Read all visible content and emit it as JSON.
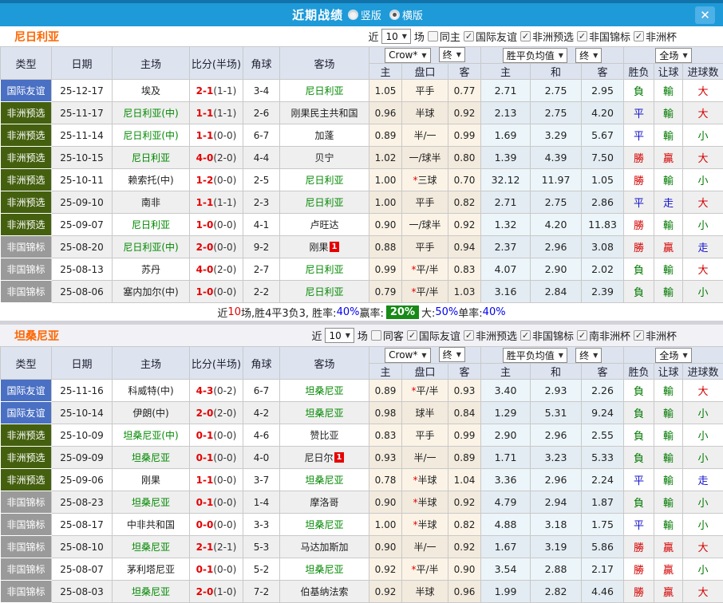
{
  "titlebar": {
    "title": "近期战绩",
    "radio_options": [
      {
        "label": "竖版",
        "selected": false
      },
      {
        "label": "横版",
        "selected": true
      }
    ],
    "close_icon": "✕"
  },
  "table_header": {
    "cols": [
      "类型",
      "日期",
      "主场",
      "比分(半场)",
      "角球",
      "客场"
    ],
    "odds_sub": [
      "主",
      "盘口",
      "客"
    ],
    "avg_sub": [
      "主",
      "和",
      "客"
    ],
    "result_sub": [
      "胜负",
      "让球",
      "进球数"
    ],
    "bookmaker_select": "Crow*",
    "final_select": "终",
    "avg_select": "胜平负均值",
    "avg_final_select": "终",
    "scope_select": "全场"
  },
  "sections": [
    {
      "team": "尼日利亚",
      "filter": {
        "prefix": "近",
        "count": "10",
        "suffix": "场",
        "same": {
          "label": "同主",
          "checked": false
        },
        "comps": [
          {
            "label": "国际友谊",
            "checked": true
          },
          {
            "label": "非洲预选",
            "checked": true
          },
          {
            "label": "非国锦标",
            "checked": true
          },
          {
            "label": "非洲杯",
            "checked": true
          }
        ]
      },
      "rows": [
        {
          "type": "国际友谊",
          "type_class": "friendly",
          "date": "25-12-17",
          "home": "埃及",
          "home_self": false,
          "home_badge": "",
          "ft": "2-1",
          "ht": "(1-1)",
          "corners": "3-4",
          "away": "尼日利亚",
          "away_self": true,
          "away_badge": "",
          "o1": "1.05",
          "star": false,
          "hcap": "平手",
          "o2": "0.77",
          "m1": "2.71",
          "m2": "2.75",
          "m3": "2.95",
          "r1": "負",
          "c1": "green",
          "r2": "輸",
          "c2": "green",
          "r3": "大",
          "c3": "red"
        },
        {
          "type": "非洲预选",
          "type_class": "qualifier",
          "date": "25-11-17",
          "home": "尼日利亚(中)",
          "home_self": true,
          "home_badge": "",
          "ft": "1-1",
          "ht": "(1-1)",
          "corners": "2-6",
          "away": "刚果民主共和国",
          "away_self": false,
          "away_badge": "",
          "o1": "0.96",
          "star": false,
          "hcap": "半球",
          "o2": "0.92",
          "m1": "2.13",
          "m2": "2.75",
          "m3": "4.20",
          "r1": "平",
          "c1": "blue",
          "r2": "輸",
          "c2": "green",
          "r3": "大",
          "c3": "red"
        },
        {
          "type": "非洲预选",
          "type_class": "qualifier",
          "date": "25-11-14",
          "home": "尼日利亚(中)",
          "home_self": true,
          "home_badge": "",
          "ft": "1-1",
          "ht": "(0-0)",
          "corners": "6-7",
          "away": "加蓬",
          "away_self": false,
          "away_badge": "",
          "o1": "0.89",
          "star": false,
          "hcap": "半/一",
          "o2": "0.99",
          "m1": "1.69",
          "m2": "3.29",
          "m3": "5.67",
          "r1": "平",
          "c1": "blue",
          "r2": "輸",
          "c2": "green",
          "r3": "小",
          "c3": "green"
        },
        {
          "type": "非洲预选",
          "type_class": "qualifier",
          "date": "25-10-15",
          "home": "尼日利亚",
          "home_self": true,
          "home_badge": "",
          "ft": "4-0",
          "ht": "(2-0)",
          "corners": "4-4",
          "away": "贝宁",
          "away_self": false,
          "away_badge": "",
          "o1": "1.02",
          "star": false,
          "hcap": "一/球半",
          "o2": "0.80",
          "m1": "1.39",
          "m2": "4.39",
          "m3": "7.50",
          "r1": "勝",
          "c1": "red",
          "r2": "贏",
          "c2": "red",
          "r3": "大",
          "c3": "red"
        },
        {
          "type": "非洲预选",
          "type_class": "qualifier",
          "date": "25-10-11",
          "home": "赖索托(中)",
          "home_self": false,
          "home_badge": "",
          "ft": "1-2",
          "ht": "(0-0)",
          "corners": "2-5",
          "away": "尼日利亚",
          "away_self": true,
          "away_badge": "",
          "o1": "1.00",
          "star": true,
          "hcap": "三球",
          "o2": "0.70",
          "m1": "32.12",
          "m2": "11.97",
          "m3": "1.05",
          "r1": "勝",
          "c1": "red",
          "r2": "輸",
          "c2": "green",
          "r3": "小",
          "c3": "green"
        },
        {
          "type": "非洲预选",
          "type_class": "qualifier",
          "date": "25-09-10",
          "home": "南非",
          "home_self": false,
          "home_badge": "",
          "ft": "1-1",
          "ht": "(1-1)",
          "corners": "2-3",
          "away": "尼日利亚",
          "away_self": true,
          "away_badge": "",
          "o1": "1.00",
          "star": false,
          "hcap": "平手",
          "o2": "0.82",
          "m1": "2.71",
          "m2": "2.75",
          "m3": "2.86",
          "r1": "平",
          "c1": "blue",
          "r2": "走",
          "c2": "blue",
          "r3": "大",
          "c3": "red"
        },
        {
          "type": "非洲预选",
          "type_class": "qualifier",
          "date": "25-09-07",
          "home": "尼日利亚",
          "home_self": true,
          "home_badge": "",
          "ft": "1-0",
          "ht": "(0-0)",
          "corners": "4-1",
          "away": "卢旺达",
          "away_self": false,
          "away_badge": "",
          "o1": "0.90",
          "star": false,
          "hcap": "一/球半",
          "o2": "0.92",
          "m1": "1.32",
          "m2": "4.20",
          "m3": "11.83",
          "r1": "勝",
          "c1": "red",
          "r2": "輸",
          "c2": "green",
          "r3": "小",
          "c3": "green"
        },
        {
          "type": "非国锦标",
          "type_class": "chan",
          "date": "25-08-20",
          "home": "尼日利亚(中)",
          "home_self": true,
          "home_badge": "",
          "ft": "2-0",
          "ht": "(0-0)",
          "corners": "9-2",
          "away": "刚果",
          "away_self": false,
          "away_badge": "1",
          "o1": "0.88",
          "star": false,
          "hcap": "平手",
          "o2": "0.94",
          "m1": "2.37",
          "m2": "2.96",
          "m3": "3.08",
          "r1": "勝",
          "c1": "red",
          "r2": "贏",
          "c2": "red",
          "r3": "走",
          "c3": "blue"
        },
        {
          "type": "非国锦标",
          "type_class": "chan",
          "date": "25-08-13",
          "home": "苏丹",
          "home_self": false,
          "home_badge": "",
          "ft": "4-0",
          "ht": "(2-0)",
          "corners": "2-7",
          "away": "尼日利亚",
          "away_self": true,
          "away_badge": "",
          "o1": "0.99",
          "star": true,
          "hcap": "平/半",
          "o2": "0.83",
          "m1": "4.07",
          "m2": "2.90",
          "m3": "2.02",
          "r1": "負",
          "c1": "green",
          "r2": "輸",
          "c2": "green",
          "r3": "大",
          "c3": "red"
        },
        {
          "type": "非国锦标",
          "type_class": "chan",
          "date": "25-08-06",
          "home": "塞内加尔(中)",
          "home_self": false,
          "home_badge": "",
          "ft": "1-0",
          "ht": "(0-0)",
          "corners": "2-2",
          "away": "尼日利亚",
          "away_self": true,
          "away_badge": "",
          "o1": "0.79",
          "star": true,
          "hcap": "平/半",
          "o2": "1.03",
          "m1": "3.16",
          "m2": "2.84",
          "m3": "2.39",
          "r1": "負",
          "c1": "green",
          "r2": "輸",
          "c2": "green",
          "r3": "小",
          "c3": "green"
        }
      ],
      "summary": [
        {
          "t": "近",
          "c": "black"
        },
        {
          "t": "10",
          "c": "red"
        },
        {
          "t": "场,胜4平3负3, 胜率:",
          "c": "black"
        },
        {
          "t": "40%",
          "c": "blue"
        },
        {
          "t": " 赢率:",
          "c": "black"
        },
        {
          "t": "20%",
          "c": "badge"
        },
        {
          "t": " 大:",
          "c": "black"
        },
        {
          "t": "50%",
          "c": "blue"
        },
        {
          "t": " 单率:",
          "c": "black"
        },
        {
          "t": "40%",
          "c": "blue"
        }
      ]
    },
    {
      "team": "坦桑尼亚",
      "filter": {
        "prefix": "近",
        "count": "10",
        "suffix": "场",
        "same": {
          "label": "同客",
          "checked": false
        },
        "comps": [
          {
            "label": "国际友谊",
            "checked": true
          },
          {
            "label": "非洲预选",
            "checked": true
          },
          {
            "label": "非国锦标",
            "checked": true
          },
          {
            "label": "南非洲杯",
            "checked": true
          },
          {
            "label": "非洲杯",
            "checked": true
          }
        ]
      },
      "rows": [
        {
          "type": "国际友谊",
          "type_class": "friendly",
          "date": "25-11-16",
          "home": "科威特(中)",
          "home_self": false,
          "home_badge": "",
          "ft": "4-3",
          "ht": "(0-2)",
          "corners": "6-7",
          "away": "坦桑尼亚",
          "away_self": true,
          "away_badge": "",
          "o1": "0.89",
          "star": true,
          "hcap": "平/半",
          "o2": "0.93",
          "m1": "3.40",
          "m2": "2.93",
          "m3": "2.26",
          "r1": "負",
          "c1": "green",
          "r2": "輸",
          "c2": "green",
          "r3": "大",
          "c3": "red"
        },
        {
          "type": "国际友谊",
          "type_class": "friendly",
          "date": "25-10-14",
          "home": "伊朗(中)",
          "home_self": false,
          "home_badge": "",
          "ft": "2-0",
          "ht": "(2-0)",
          "corners": "4-2",
          "away": "坦桑尼亚",
          "away_self": true,
          "away_badge": "",
          "o1": "0.98",
          "star": false,
          "hcap": "球半",
          "o2": "0.84",
          "m1": "1.29",
          "m2": "5.31",
          "m3": "9.24",
          "r1": "負",
          "c1": "green",
          "r2": "輸",
          "c2": "green",
          "r3": "小",
          "c3": "green"
        },
        {
          "type": "非洲预选",
          "type_class": "qualifier",
          "date": "25-10-09",
          "home": "坦桑尼亚(中)",
          "home_self": true,
          "home_badge": "",
          "ft": "0-1",
          "ht": "(0-0)",
          "corners": "4-6",
          "away": "赞比亚",
          "away_self": false,
          "away_badge": "",
          "o1": "0.83",
          "star": false,
          "hcap": "平手",
          "o2": "0.99",
          "m1": "2.90",
          "m2": "2.96",
          "m3": "2.55",
          "r1": "負",
          "c1": "green",
          "r2": "輸",
          "c2": "green",
          "r3": "小",
          "c3": "green"
        },
        {
          "type": "非洲预选",
          "type_class": "qualifier",
          "date": "25-09-09",
          "home": "坦桑尼亚",
          "home_self": true,
          "home_badge": "",
          "ft": "0-1",
          "ht": "(0-0)",
          "corners": "4-0",
          "away": "尼日尔",
          "away_self": false,
          "away_badge": "1",
          "o1": "0.93",
          "star": false,
          "hcap": "半/一",
          "o2": "0.89",
          "m1": "1.71",
          "m2": "3.23",
          "m3": "5.33",
          "r1": "負",
          "c1": "green",
          "r2": "輸",
          "c2": "green",
          "r3": "小",
          "c3": "green"
        },
        {
          "type": "非洲预选",
          "type_class": "qualifier",
          "date": "25-09-06",
          "home": "刚果",
          "home_self": false,
          "home_badge": "",
          "ft": "1-1",
          "ht": "(0-0)",
          "corners": "3-7",
          "away": "坦桑尼亚",
          "away_self": true,
          "away_badge": "",
          "o1": "0.78",
          "star": true,
          "hcap": "半球",
          "o2": "1.04",
          "m1": "3.36",
          "m2": "2.96",
          "m3": "2.24",
          "r1": "平",
          "c1": "blue",
          "r2": "輸",
          "c2": "green",
          "r3": "走",
          "c3": "blue"
        },
        {
          "type": "非国锦标",
          "type_class": "chan",
          "date": "25-08-23",
          "home": "坦桑尼亚",
          "home_self": true,
          "home_badge": "",
          "ft": "0-1",
          "ht": "(0-0)",
          "corners": "1-4",
          "away": "摩洛哥",
          "away_self": false,
          "away_badge": "",
          "o1": "0.90",
          "star": true,
          "hcap": "半球",
          "o2": "0.92",
          "m1": "4.79",
          "m2": "2.94",
          "m3": "1.87",
          "r1": "負",
          "c1": "green",
          "r2": "輸",
          "c2": "green",
          "r3": "小",
          "c3": "green"
        },
        {
          "type": "非国锦标",
          "type_class": "chan",
          "date": "25-08-17",
          "home": "中非共和国",
          "home_self": false,
          "home_badge": "",
          "ft": "0-0",
          "ht": "(0-0)",
          "corners": "3-3",
          "away": "坦桑尼亚",
          "away_self": true,
          "away_badge": "",
          "o1": "1.00",
          "star": true,
          "hcap": "半球",
          "o2": "0.82",
          "m1": "4.88",
          "m2": "3.18",
          "m3": "1.75",
          "r1": "平",
          "c1": "blue",
          "r2": "輸",
          "c2": "green",
          "r3": "小",
          "c3": "green"
        },
        {
          "type": "非国锦标",
          "type_class": "chan",
          "date": "25-08-10",
          "home": "坦桑尼亚",
          "home_self": true,
          "home_badge": "",
          "ft": "2-1",
          "ht": "(2-1)",
          "corners": "5-3",
          "away": "马达加斯加",
          "away_self": false,
          "away_badge": "",
          "o1": "0.90",
          "star": false,
          "hcap": "半/一",
          "o2": "0.92",
          "m1": "1.67",
          "m2": "3.19",
          "m3": "5.86",
          "r1": "勝",
          "c1": "red",
          "r2": "贏",
          "c2": "red",
          "r3": "大",
          "c3": "red"
        },
        {
          "type": "非国锦标",
          "type_class": "chan",
          "date": "25-08-07",
          "home": "茅利塔尼亚",
          "home_self": false,
          "home_badge": "",
          "ft": "0-1",
          "ht": "(0-0)",
          "corners": "5-2",
          "away": "坦桑尼亚",
          "away_self": true,
          "away_badge": "",
          "o1": "0.92",
          "star": true,
          "hcap": "平/半",
          "o2": "0.90",
          "m1": "3.54",
          "m2": "2.88",
          "m3": "2.17",
          "r1": "勝",
          "c1": "red",
          "r2": "贏",
          "c2": "red",
          "r3": "小",
          "c3": "green"
        },
        {
          "type": "非国锦标",
          "type_class": "chan",
          "date": "25-08-03",
          "home": "坦桑尼亚",
          "home_self": true,
          "home_badge": "",
          "ft": "2-0",
          "ht": "(1-0)",
          "corners": "7-2",
          "away": "伯基纳法索",
          "away_self": false,
          "away_badge": "",
          "o1": "0.92",
          "star": false,
          "hcap": "半球",
          "o2": "0.96",
          "m1": "1.99",
          "m2": "2.82",
          "m3": "4.46",
          "r1": "勝",
          "c1": "red",
          "r2": "贏",
          "c2": "red",
          "r3": "大",
          "c3": "red"
        }
      ],
      "summary": []
    }
  ]
}
